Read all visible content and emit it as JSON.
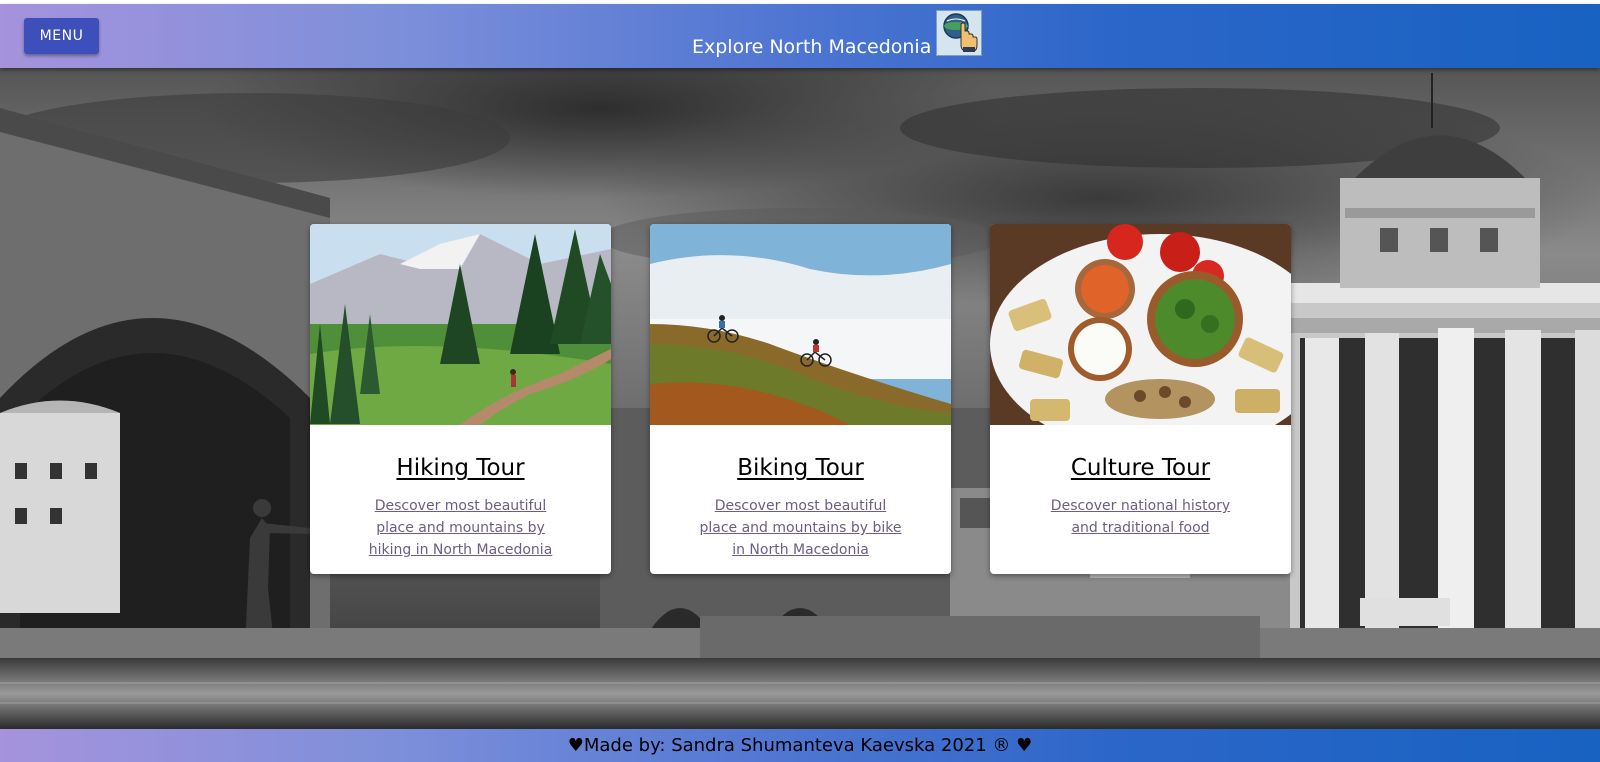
{
  "header": {
    "menu_label": "MENU",
    "title": "Explore North Macedonia",
    "logo_icon": "touch-globe-icon"
  },
  "tours": [
    {
      "title": "Hiking Tour",
      "description": "Descover most beautiful place and mountains by hiking in North Macedonia"
    },
    {
      "title": "Biking Tour",
      "description": "Descover most beautiful place and mountains by bike in North Macedonia"
    },
    {
      "title": "Culture Tour",
      "description": "Descover national history and traditional food"
    }
  ],
  "footer": {
    "text": "♥Made by: Sandra Shumanteva Kaevska 2021 ® ♥"
  },
  "colors": {
    "header_gradient_start": "#a593dc",
    "header_gradient_end": "#1862c2",
    "menu_button": "#3d4fba",
    "link_text": "#6d5d86"
  }
}
